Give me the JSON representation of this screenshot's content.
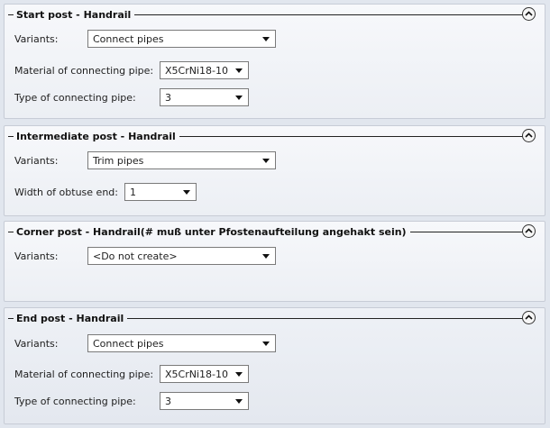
{
  "sections": [
    {
      "title": "Start post - Handrail",
      "variants_label": "Variants:",
      "variants_value": "Connect pipes",
      "material_label": "Material of connecting pipe:",
      "material_value": "X5CrNi18-10",
      "type_label": "Type of connecting pipe:",
      "type_value": "3"
    },
    {
      "title": "Intermediate post - Handrail",
      "variants_label": "Variants:",
      "variants_value": "Trim pipes",
      "width_label": "Width of obtuse end:",
      "width_value": "1"
    },
    {
      "title": "Corner post - Handrail(# muß unter Pfostenaufteilung angehakt sein)",
      "variants_label": "Variants:",
      "variants_value": "<Do not create>"
    },
    {
      "title": "End post - Handrail",
      "variants_label": "Variants:",
      "variants_value": "Connect pipes",
      "material_label": "Material of connecting pipe:",
      "material_value": "X5CrNi18-10",
      "type_label": "Type of connecting pipe:",
      "type_value": "3"
    }
  ]
}
